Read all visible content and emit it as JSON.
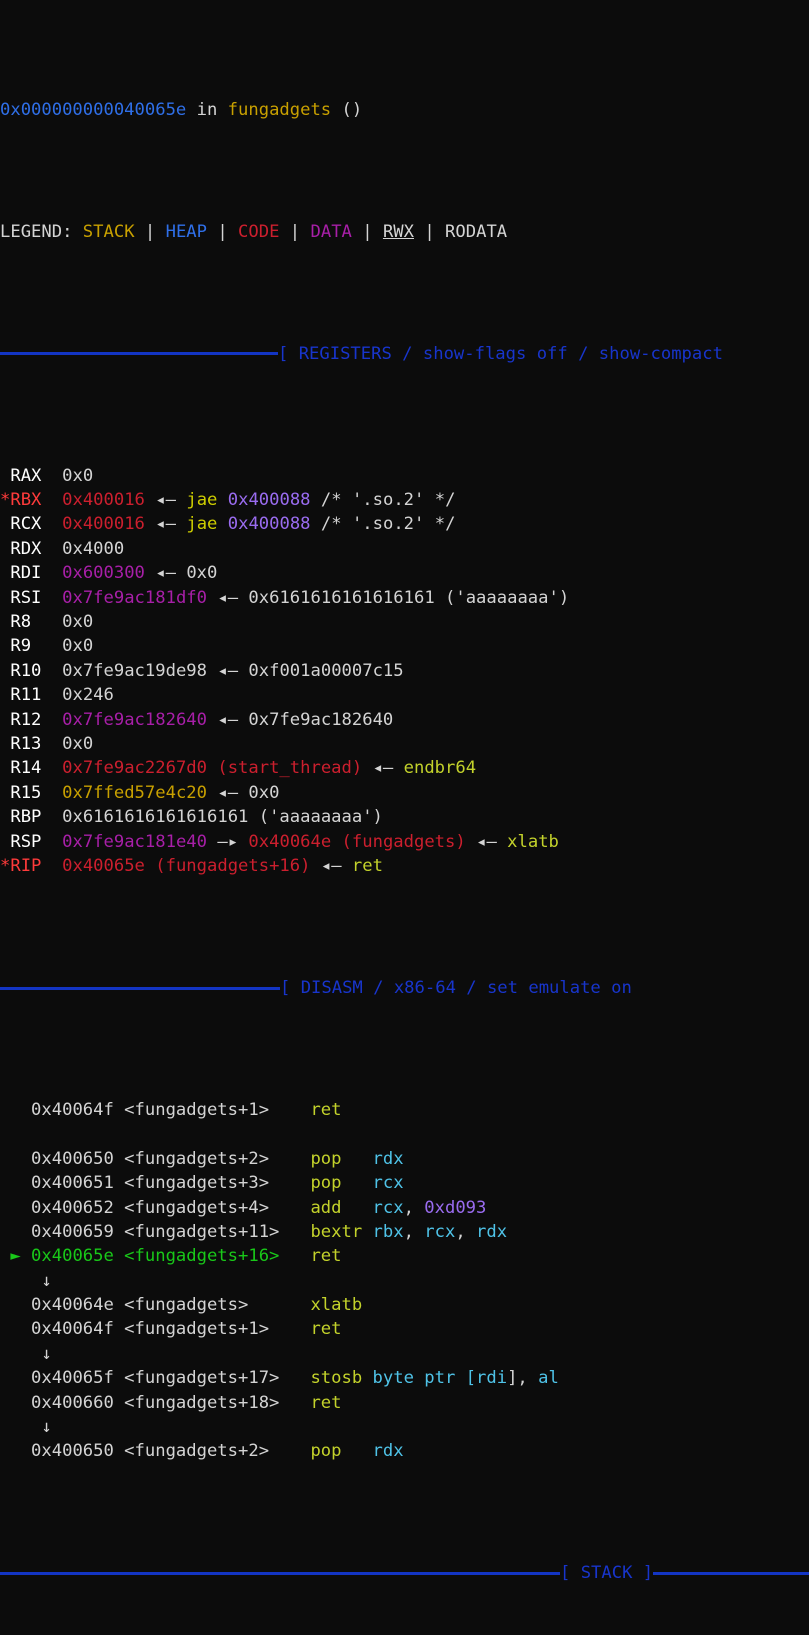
{
  "terminal": {
    "background": "#0c0c0c",
    "foreground": "#d4d4d4",
    "accent_blue": "#1335c4"
  },
  "status_line": {
    "address": "0x000000000040065e",
    "in_word": " in ",
    "symbol": "fungadgets",
    "parens": " ()"
  },
  "legend": {
    "label": "LEGEND: ",
    "items": [
      {
        "name": "STACK",
        "color": "#c8a000"
      },
      {
        "name": "HEAP",
        "color": "#2f6fe8"
      },
      {
        "name": "CODE",
        "color": "#cc1f2e"
      },
      {
        "name": "DATA",
        "color": "#a81fa8"
      },
      {
        "name": "RWX",
        "color": "#d4d4d4"
      },
      {
        "name": "RODATA",
        "color": "#d4d4d4"
      }
    ],
    "separator": " | "
  },
  "panels": {
    "registers_header": "[ REGISTERS / show-flags off / show-compact",
    "disasm_header": "[ DISASM / x86-64 / set emulate on",
    "stack_header": "[ STACK ]"
  },
  "registers": [
    {
      "marker": " ",
      "name": "RAX",
      "parts": [
        {
          "t": "0x0",
          "c": "white"
        }
      ]
    },
    {
      "marker": "*",
      "name": "RBX",
      "marker_color": "brred",
      "name_color": "brred",
      "parts": [
        {
          "t": "0x400016",
          "c": "red"
        },
        {
          "t": " ",
          "c": "white"
        },
        {
          "t": "◂—",
          "c": "white"
        },
        {
          "t": " ",
          "c": "white"
        },
        {
          "t": "jae",
          "c": "yellow"
        },
        {
          "t": " ",
          "c": "white"
        },
        {
          "t": "0x400088",
          "c": "purple"
        },
        {
          "t": " /* '.so.2' */",
          "c": "white"
        }
      ]
    },
    {
      "marker": " ",
      "name": "RCX",
      "parts": [
        {
          "t": "0x400016",
          "c": "red"
        },
        {
          "t": " ",
          "c": "white"
        },
        {
          "t": "◂—",
          "c": "white"
        },
        {
          "t": " ",
          "c": "white"
        },
        {
          "t": "jae",
          "c": "yellow"
        },
        {
          "t": " ",
          "c": "white"
        },
        {
          "t": "0x400088",
          "c": "purple"
        },
        {
          "t": " /* '.so.2' */",
          "c": "white"
        }
      ]
    },
    {
      "marker": " ",
      "name": "RDX",
      "parts": [
        {
          "t": "0x4000",
          "c": "white"
        }
      ]
    },
    {
      "marker": " ",
      "name": "RDI",
      "parts": [
        {
          "t": "0x600300",
          "c": "magenta"
        },
        {
          "t": " ",
          "c": "white"
        },
        {
          "t": "◂—",
          "c": "white"
        },
        {
          "t": " 0x0",
          "c": "white"
        }
      ]
    },
    {
      "marker": " ",
      "name": "RSI",
      "parts": [
        {
          "t": "0x7fe9ac181df0",
          "c": "magenta"
        },
        {
          "t": " ",
          "c": "white"
        },
        {
          "t": "◂—",
          "c": "white"
        },
        {
          "t": " 0x6161616161616161 ('aaaaaaaa')",
          "c": "white"
        }
      ]
    },
    {
      "marker": " ",
      "name": "R8",
      "parts": [
        {
          "t": "0x0",
          "c": "white"
        }
      ]
    },
    {
      "marker": " ",
      "name": "R9",
      "parts": [
        {
          "t": "0x0",
          "c": "white"
        }
      ]
    },
    {
      "marker": " ",
      "name": "R10",
      "parts": [
        {
          "t": "0x7fe9ac19de98",
          "c": "white"
        },
        {
          "t": " ",
          "c": "white"
        },
        {
          "t": "◂—",
          "c": "white"
        },
        {
          "t": " 0xf001a00007c15",
          "c": "white"
        }
      ]
    },
    {
      "marker": " ",
      "name": "R11",
      "parts": [
        {
          "t": "0x246",
          "c": "white"
        }
      ]
    },
    {
      "marker": " ",
      "name": "R12",
      "parts": [
        {
          "t": "0x7fe9ac182640",
          "c": "magenta"
        },
        {
          "t": " ",
          "c": "white"
        },
        {
          "t": "◂—",
          "c": "white"
        },
        {
          "t": " 0x7fe9ac182640",
          "c": "white"
        }
      ]
    },
    {
      "marker": " ",
      "name": "R13",
      "parts": [
        {
          "t": "0x0",
          "c": "white"
        }
      ]
    },
    {
      "marker": " ",
      "name": "R14",
      "parts": [
        {
          "t": "0x7fe9ac2267d0 (start_thread)",
          "c": "red"
        },
        {
          "t": " ",
          "c": "white"
        },
        {
          "t": "◂—",
          "c": "white"
        },
        {
          "t": " ",
          "c": "white"
        },
        {
          "t": "endbr64",
          "c": "olive"
        }
      ]
    },
    {
      "marker": " ",
      "name": "R15",
      "parts": [
        {
          "t": "0x7ffed57e4c20",
          "c": "gold"
        },
        {
          "t": " ",
          "c": "white"
        },
        {
          "t": "◂—",
          "c": "white"
        },
        {
          "t": " 0x0",
          "c": "white"
        }
      ]
    },
    {
      "marker": " ",
      "name": "RBP",
      "parts": [
        {
          "t": "0x6161616161616161 ('aaaaaaaa')",
          "c": "white"
        }
      ]
    },
    {
      "marker": " ",
      "name": "RSP",
      "parts": [
        {
          "t": "0x7fe9ac181e40",
          "c": "magenta"
        },
        {
          "t": " ",
          "c": "white"
        },
        {
          "t": "—▸",
          "c": "white"
        },
        {
          "t": " ",
          "c": "white"
        },
        {
          "t": "0x40064e (fungadgets)",
          "c": "red"
        },
        {
          "t": " ",
          "c": "white"
        },
        {
          "t": "◂—",
          "c": "white"
        },
        {
          "t": " ",
          "c": "white"
        },
        {
          "t": "xlatb",
          "c": "olive"
        }
      ]
    },
    {
      "marker": "*",
      "name": "RIP",
      "marker_color": "brred",
      "name_color": "brred",
      "parts": [
        {
          "t": "0x40065e (fungadgets+16)",
          "c": "red"
        },
        {
          "t": " ",
          "c": "white"
        },
        {
          "t": "◂—",
          "c": "white"
        },
        {
          "t": " ",
          "c": "white"
        },
        {
          "t": "ret",
          "c": "olive"
        }
      ]
    }
  ],
  "disasm": [
    {
      "type": "insn",
      "current": false,
      "addr": "0x40064f",
      "sym": "<fungadgets+1>",
      "mnemonic": "ret",
      "ops": []
    },
    {
      "type": "blank"
    },
    {
      "type": "insn",
      "current": false,
      "addr": "0x400650",
      "sym": "<fungadgets+2>",
      "mnemonic": "pop",
      "ops": [
        {
          "t": "rdx",
          "c": "cyan"
        }
      ]
    },
    {
      "type": "insn",
      "current": false,
      "addr": "0x400651",
      "sym": "<fungadgets+3>",
      "mnemonic": "pop",
      "ops": [
        {
          "t": "rcx",
          "c": "cyan"
        }
      ]
    },
    {
      "type": "insn",
      "current": false,
      "addr": "0x400652",
      "sym": "<fungadgets+4>",
      "mnemonic": "add",
      "ops": [
        {
          "t": "rcx",
          "c": "cyan"
        },
        {
          "t": ", ",
          "c": "white"
        },
        {
          "t": "0xd093",
          "c": "purple"
        }
      ]
    },
    {
      "type": "insn",
      "current": false,
      "addr": "0x400659",
      "sym": "<fungadgets+11>",
      "mnemonic": "bextr",
      "ops": [
        {
          "t": "rbx",
          "c": "cyan"
        },
        {
          "t": ", ",
          "c": "white"
        },
        {
          "t": "rcx",
          "c": "cyan"
        },
        {
          "t": ", ",
          "c": "white"
        },
        {
          "t": "rdx",
          "c": "cyan"
        }
      ]
    },
    {
      "type": "insn",
      "current": true,
      "addr": "0x40065e",
      "sym": "<fungadgets+16>",
      "mnemonic": "ret",
      "ops": []
    },
    {
      "type": "branch",
      "glyph": "↓"
    },
    {
      "type": "insn",
      "current": false,
      "addr": "0x40064e",
      "sym": "<fungadgets>",
      "mnemonic": "xlatb",
      "ops": []
    },
    {
      "type": "insn",
      "current": false,
      "addr": "0x40064f",
      "sym": "<fungadgets+1>",
      "mnemonic": "ret",
      "ops": []
    },
    {
      "type": "branch",
      "glyph": "↓"
    },
    {
      "type": "insn",
      "current": false,
      "addr": "0x40065f",
      "sym": "<fungadgets+17>",
      "mnemonic": "stosb",
      "ops": [
        {
          "t": "byte ptr [",
          "c": "cyan"
        },
        {
          "t": "rdi",
          "c": "cyan"
        },
        {
          "t": "], ",
          "c": "white"
        },
        {
          "t": "al",
          "c": "cyan"
        }
      ]
    },
    {
      "type": "insn",
      "current": false,
      "addr": "0x400660",
      "sym": "<fungadgets+18>",
      "mnemonic": "ret",
      "ops": []
    },
    {
      "type": "branch",
      "glyph": "↓"
    },
    {
      "type": "insn",
      "current": false,
      "addr": "0x400650",
      "sym": "<fungadgets+2>",
      "mnemonic": "pop",
      "ops": [
        {
          "t": "rdx",
          "c": "cyan"
        }
      ]
    }
  ],
  "current_marker": "►"
}
